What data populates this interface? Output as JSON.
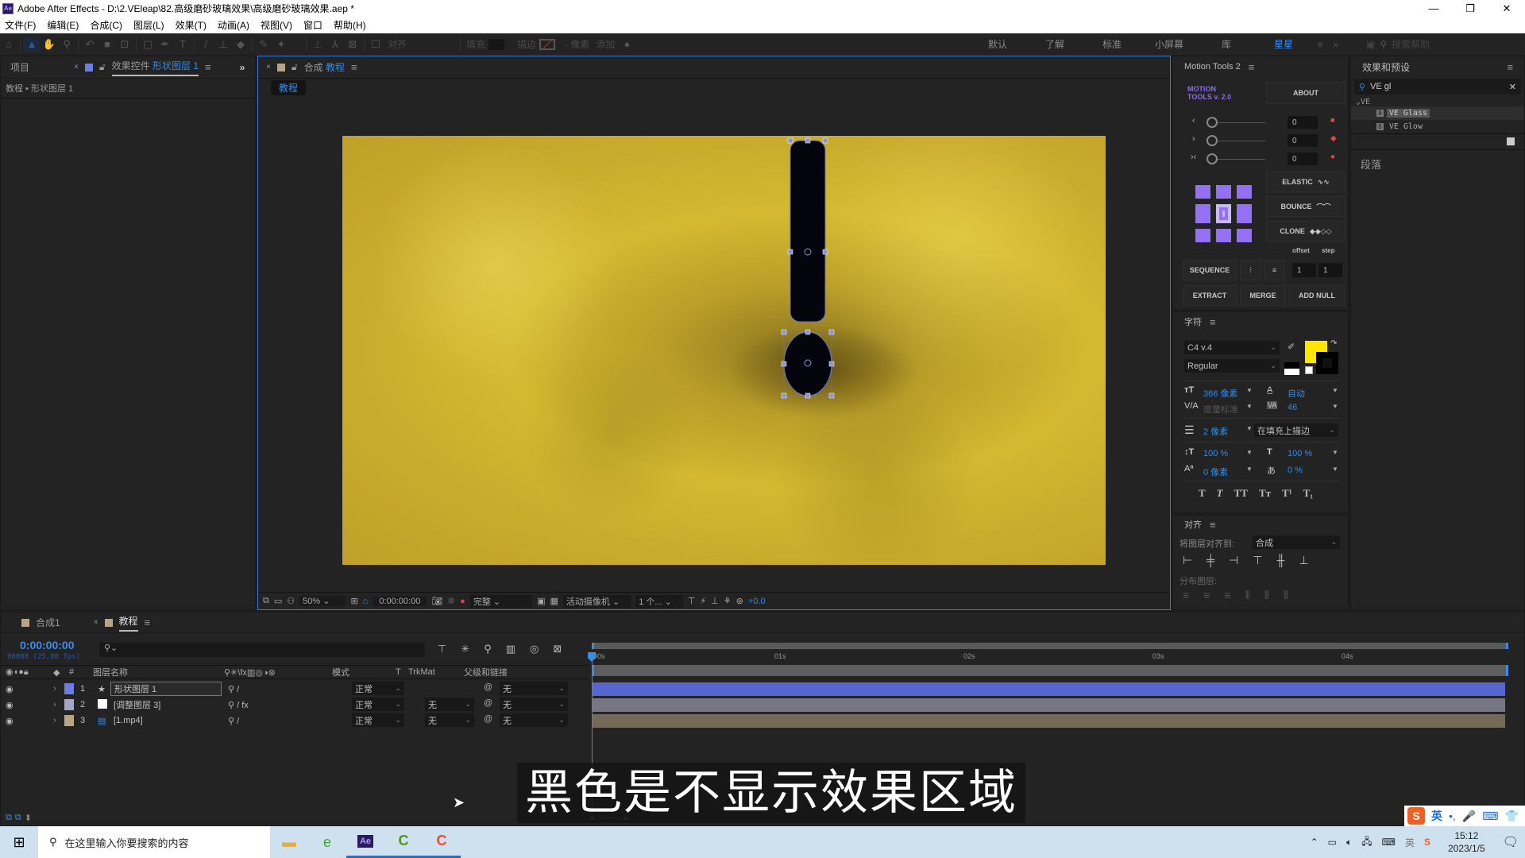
{
  "window": {
    "title": "Adobe After Effects - D:\\2.VEleap\\82.高级磨砂玻璃效果\\高级磨砂玻璃效果.aep *",
    "app_icon": "Ae",
    "controls": [
      "—",
      "❐",
      "✕"
    ]
  },
  "menu": [
    "文件(F)",
    "编辑(E)",
    "合成(C)",
    "图层(L)",
    "效果(T)",
    "动画(A)",
    "视图(V)",
    "窗口",
    "帮助(H)"
  ],
  "toolbar": {
    "tools": [
      "home-icon",
      "selection-icon",
      "hand-icon",
      "zoom-icon",
      "rotate-icon",
      "camera-icon",
      "pan-behind-icon",
      "rectangle-icon",
      "pen-icon",
      "text-icon",
      "brush-icon",
      "clone-stamp-icon",
      "eraser-icon",
      "roto-brush-icon",
      "puppet-icon"
    ],
    "align_label": "对齐",
    "fill_label": "填充",
    "stroke_label": "描边",
    "stroke_px": "- 像素",
    "add_label": "添加",
    "workspaces": [
      "默认",
      "了解",
      "标准",
      "小屏幕",
      "库",
      "星星"
    ],
    "active_workspace": "星星",
    "help_search_placeholder": "搜索帮助"
  },
  "left_panel": {
    "tab_project": "项目",
    "tab_effect_controls_prefix": "效果控件",
    "tab_effect_controls_layer": "形状图层 1",
    "breadcrumb": "教程 • 形状图层 1"
  },
  "viewer": {
    "tab_prefix": "合成",
    "tab_comp": "教程",
    "comp_chip": "教程",
    "zoom": "50%",
    "timecode": "0:00:00:00",
    "resolution": "完整",
    "camera": "活动摄像机",
    "views": "1 个...",
    "exposure": "+0.0"
  },
  "motion_tools": {
    "title": "Motion Tools 2",
    "logo_line1": "MOTION",
    "logo_line2": "TOOLS v. 2.0",
    "about": "ABOUT",
    "sliders": [
      {
        "icon": "‹",
        "value": "0",
        "key": "■"
      },
      {
        "icon": "›",
        "value": "0",
        "key": "◆"
      },
      {
        "icon": "›‹",
        "value": "0",
        "key": "●"
      }
    ],
    "elastic": "ELASTIC",
    "bounce": "BOUNCE",
    "clone": "CLONE",
    "offset_label": "offset",
    "step_label": "step",
    "sequence": "SEQUENCE",
    "offset_value": "1",
    "step_value": "1",
    "extract": "EXTRACT",
    "merge": "MERGE",
    "add_null": "ADD NULL"
  },
  "effects_presets": {
    "title": "效果和预设",
    "search_value": "VE gl",
    "folder": "VE",
    "items": [
      "VE Glass",
      "VE Glow"
    ],
    "paragraph_title": "段落"
  },
  "character": {
    "title": "字符",
    "font": "C4 v.4",
    "style": "Regular",
    "size": "366 像素",
    "leading": "自动",
    "kerning": "度量标准",
    "tracking": "46",
    "stroke_width": "2 像素",
    "stroke_mode": "在填充上描边",
    "vscale": "100 %",
    "hscale": "100 %",
    "baseline": "0 像素",
    "tsume": "0 %",
    "fill_color": "#ffe500",
    "stroke_color": "#000000",
    "styles": [
      "T",
      "T",
      "TT",
      "Tт",
      "T¹",
      "T₁"
    ]
  },
  "align": {
    "title": "对齐",
    "align_to_label": "将图层对齐到:",
    "align_to_value": "合成",
    "distribute_label": "分布图层:"
  },
  "timeline": {
    "tabs": [
      {
        "label": "合成1",
        "color": "#b8a582"
      },
      {
        "label": "教程",
        "color": "#b8a582"
      }
    ],
    "timecode": "0:00:00:00",
    "frame_info": "00000 (25.00 fps)",
    "headers": {
      "name": "图层名称",
      "mode": "模式",
      "t": "T",
      "trkmat": "TrkMat",
      "parent": "父级和链接"
    },
    "layers": [
      {
        "num": "1",
        "name": "形状图层 1",
        "color": "#6b7fe0",
        "mode": "正常",
        "trkmat": "",
        "parent": "无",
        "bar": "#5567cc"
      },
      {
        "num": "2",
        "name": "[调整图层 3]",
        "color": "#a6a6c8",
        "mode": "正常",
        "trkmat": "无",
        "parent": "无",
        "bar": "#767584"
      },
      {
        "num": "3",
        "name": "[1.mp4]",
        "color": "#b8a582",
        "mode": "正常",
        "trkmat": "无",
        "parent": "无",
        "bar": "#756a57"
      }
    ],
    "ruler": [
      "00s",
      "01s",
      "02s",
      "03s",
      "04s"
    ]
  },
  "subtitle": "黑色是不显示效果区域",
  "taskbar": {
    "search_placeholder": "在这里输入你要搜索的内容",
    "time": "15:12",
    "date": "2023/1/5",
    "ime": "英",
    "ime_bar": [
      "英",
      "•,",
      "🎤",
      "⌨",
      "👕"
    ]
  }
}
